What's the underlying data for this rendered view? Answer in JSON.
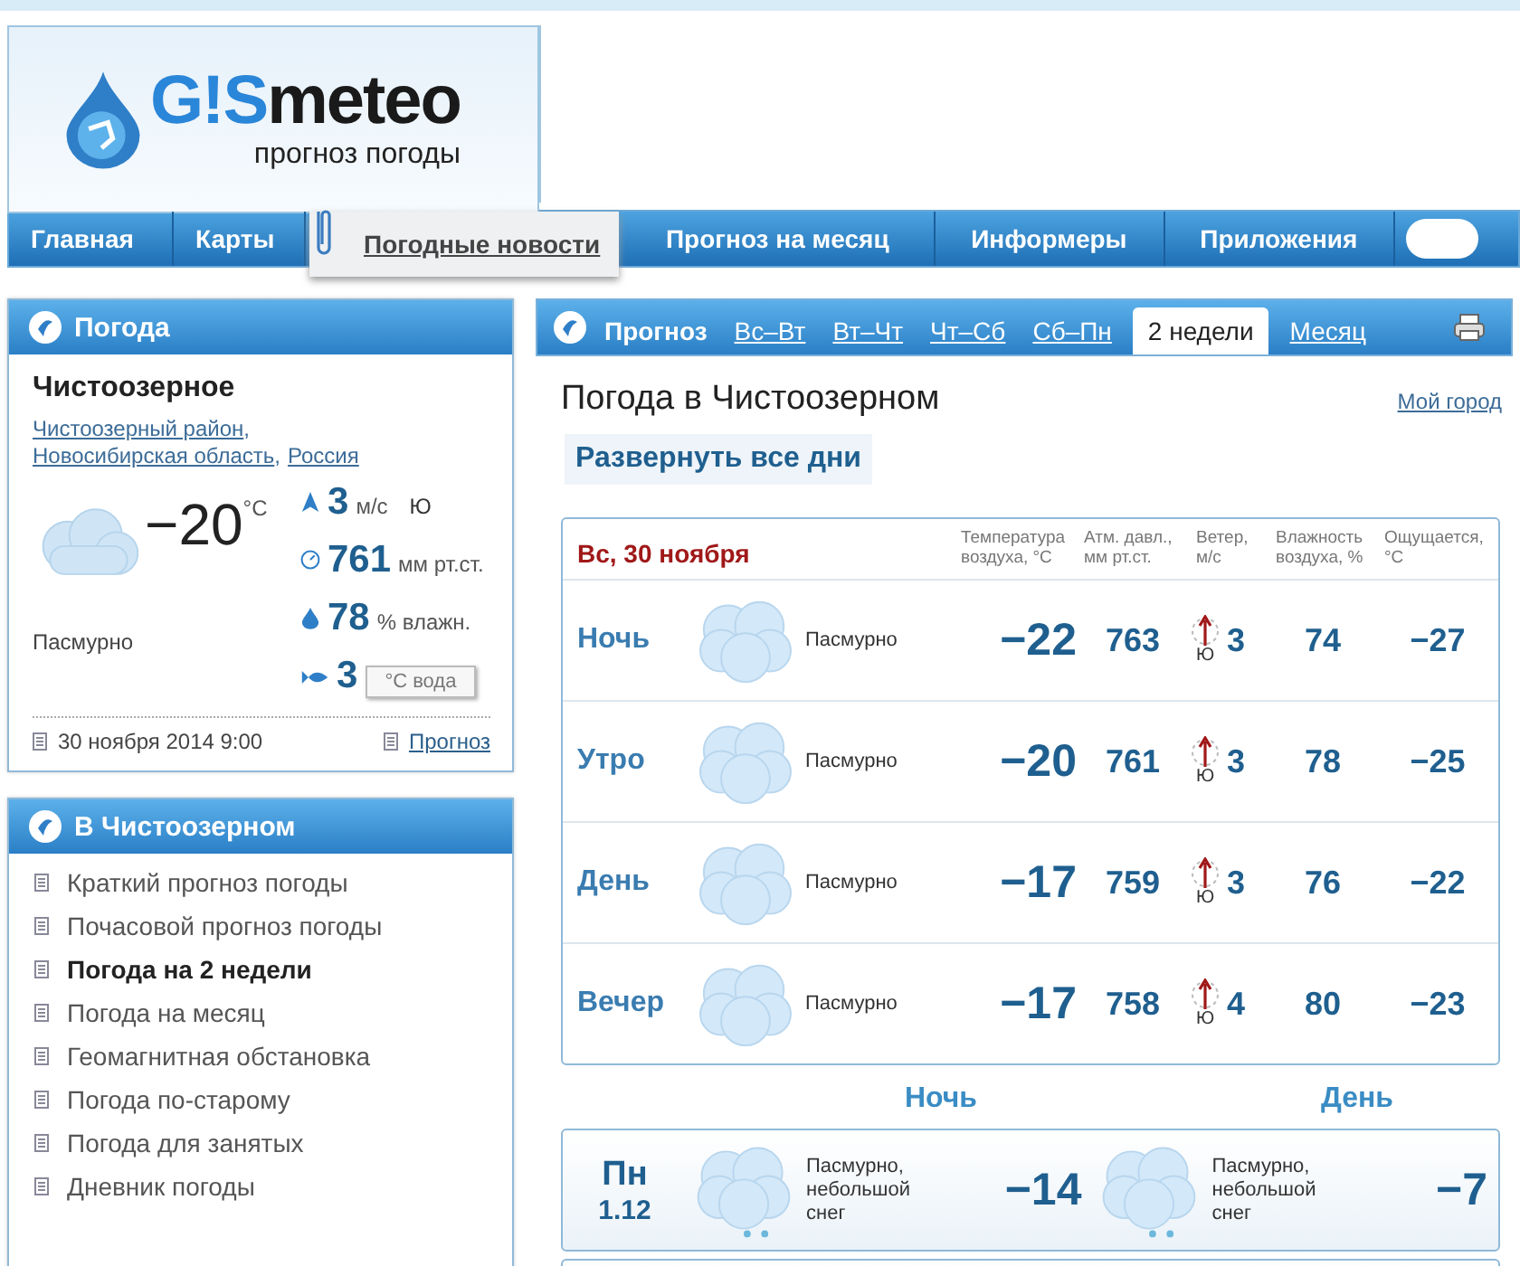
{
  "logo": {
    "brand_a": "G!S",
    "brand_b": "meteo",
    "tagline": "прогноз погоды"
  },
  "nav": [
    {
      "label": "Главная",
      "kind": "plain"
    },
    {
      "label": "Карты",
      "kind": "plain"
    },
    {
      "label": "Погодные новости",
      "kind": "news"
    },
    {
      "label": "Прогноз на месяц",
      "kind": "plain"
    },
    {
      "label": "Информеры",
      "kind": "plain"
    },
    {
      "label": "Приложения",
      "kind": "plain"
    }
  ],
  "now_panel": {
    "title": "Погода",
    "city": "Чистоозерное",
    "region": [
      {
        "text": "Чистоозерный район",
        "sep": ","
      },
      {
        "text": "Новосибирская область",
        "sep": ","
      },
      {
        "text": "Россия"
      }
    ],
    "temp": "−20",
    "temp_unit": "°C",
    "condition": "Пасмурно",
    "stats": [
      {
        "kind": "wind",
        "value": "3",
        "unit": "м/с",
        "extra": "Ю"
      },
      {
        "kind": "pressure",
        "value": "761",
        "unit": "мм рт.ст."
      },
      {
        "kind": "humidity",
        "value": "78",
        "unit": "% влажн."
      },
      {
        "kind": "water",
        "value": "3",
        "unit": "°С вода"
      }
    ],
    "date": "30 ноября 2014 9:00",
    "forecast_link": "Прогноз"
  },
  "local_panel": {
    "title": "В Чистоозерном",
    "items": [
      {
        "label": "Краткий прогноз погоды",
        "selected": false
      },
      {
        "label": "Почасовой прогноз погоды",
        "selected": false
      },
      {
        "label": "Погода на 2 недели",
        "selected": true
      },
      {
        "label": "Погода на месяц",
        "selected": false
      },
      {
        "label": "Геомагнитная обстановка",
        "selected": false
      },
      {
        "label": "Погода по-старому",
        "selected": false
      },
      {
        "label": "Погода для занятых",
        "selected": false
      },
      {
        "label": "Дневник погоды",
        "selected": false
      }
    ]
  },
  "forecast": {
    "label": "Прогноз",
    "tabs": [
      {
        "label": "Вс–Вт",
        "selected": false
      },
      {
        "label": "Вт–Чт",
        "selected": false
      },
      {
        "label": "Чт–Сб",
        "selected": false
      },
      {
        "label": "Сб–Пн",
        "selected": false
      },
      {
        "label": "2 недели",
        "selected": true
      },
      {
        "label": "Месяц",
        "selected": false
      }
    ],
    "title": "Погода в Чистоозерном",
    "my_city": "Мой город",
    "expand_button": "Развернуть все дни",
    "today": {
      "date": "Вс, 30 ноября",
      "columns": [
        "Температура воздуха, °С",
        "Атм. давл., мм рт.ст.",
        "Ветер, м/с",
        "Влажность воздуха, %",
        "Ощущается, °С"
      ],
      "rows": [
        {
          "period": "Ночь",
          "kind": "overcast",
          "condition": "Пасмурно",
          "temp": "−22",
          "pressure": "763",
          "wind_dir": "Ю",
          "wind": "3",
          "humidity": "74",
          "feels": "−27"
        },
        {
          "period": "Утро",
          "kind": "overcast",
          "condition": "Пасмурно",
          "temp": "−20",
          "pressure": "761",
          "wind_dir": "Ю",
          "wind": "3",
          "humidity": "78",
          "feels": "−25"
        },
        {
          "period": "День",
          "kind": "overcast",
          "condition": "Пасмурно",
          "temp": "−17",
          "pressure": "759",
          "wind_dir": "Ю",
          "wind": "3",
          "humidity": "76",
          "feels": "−22"
        },
        {
          "period": "Вечер",
          "kind": "overcast",
          "condition": "Пасмурно",
          "temp": "−17",
          "pressure": "758",
          "wind_dir": "Ю",
          "wind": "4",
          "humidity": "80",
          "feels": "−23"
        }
      ]
    },
    "day_headers": [
      "Ночь",
      "День"
    ],
    "days": [
      {
        "weekday": "Пн",
        "date": "1.12",
        "parts": [
          {
            "kind": "snow",
            "condition": "Пасмурно, небольшой снег",
            "temp": "−14"
          },
          {
            "kind": "snow",
            "condition": "Пасмурно, небольшой снег",
            "temp": "−7"
          }
        ]
      }
    ]
  }
}
